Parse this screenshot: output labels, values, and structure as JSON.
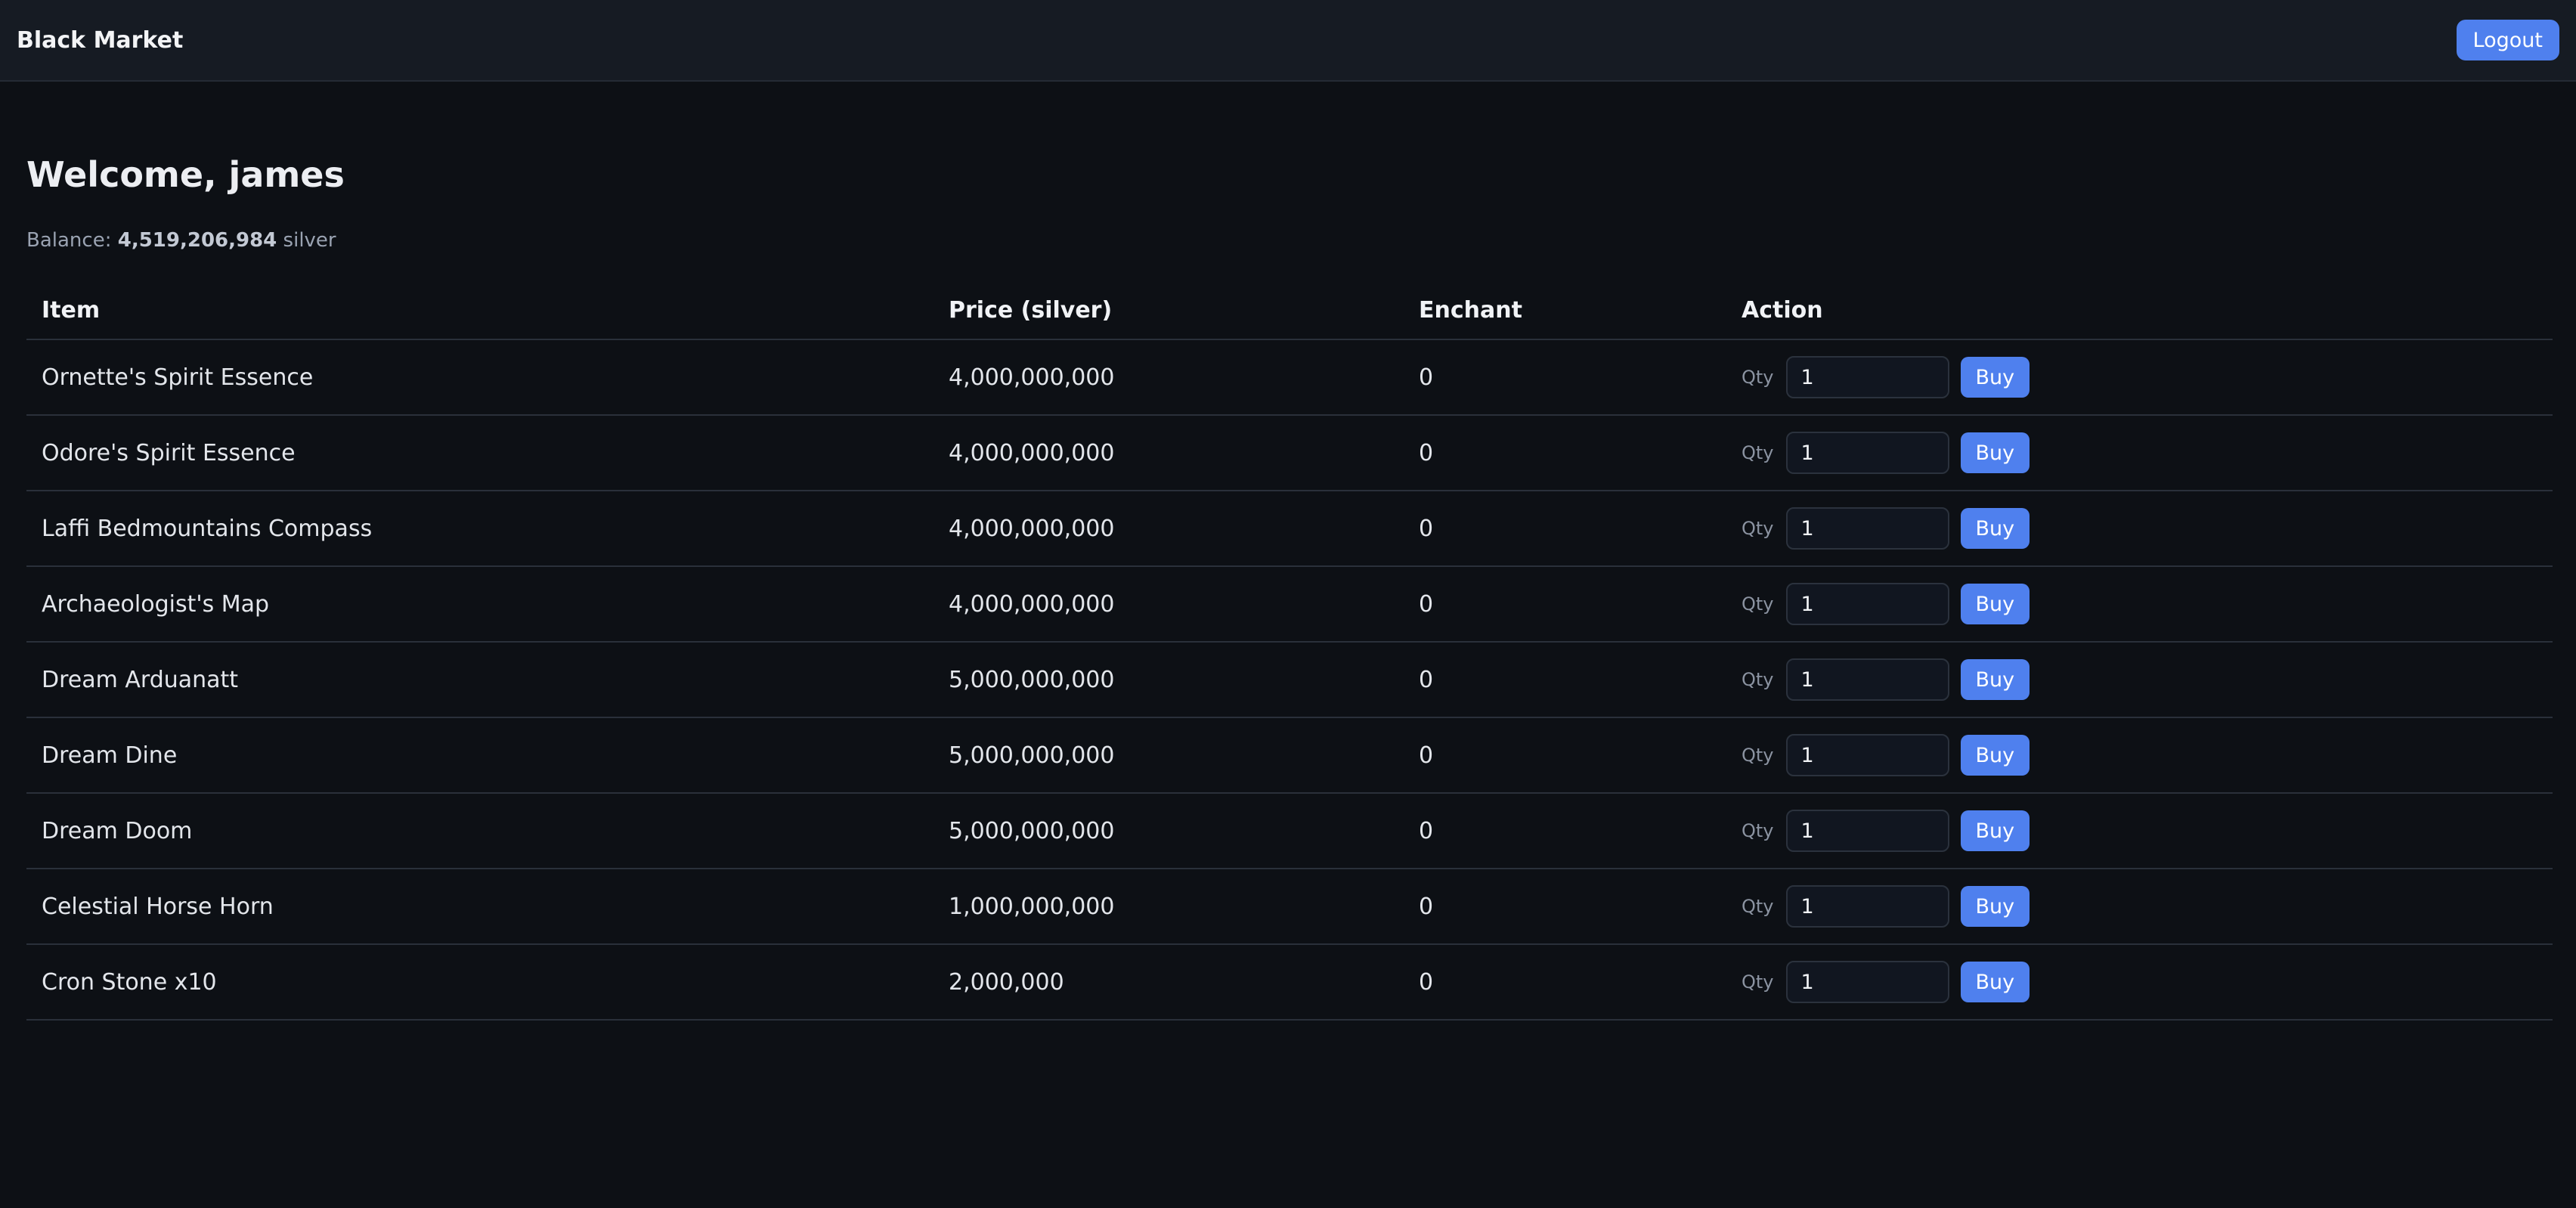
{
  "header": {
    "brand": "Black Market",
    "logout_label": "Logout"
  },
  "welcome": {
    "text": "Welcome, james"
  },
  "balance": {
    "label": "Balance: ",
    "amount": "4,519,206,984",
    "unit": " silver"
  },
  "table": {
    "columns": [
      "Item",
      "Price (silver)",
      "Enchant",
      "Action"
    ],
    "qty_label": "Qty",
    "buy_label": "Buy",
    "rows": [
      {
        "item": "Ornette's Spirit Essence",
        "price": "4,000,000,000",
        "enchant": "0",
        "qty": "1"
      },
      {
        "item": "Odore's Spirit Essence",
        "price": "4,000,000,000",
        "enchant": "0",
        "qty": "1"
      },
      {
        "item": "Laffi Bedmountains Compass",
        "price": "4,000,000,000",
        "enchant": "0",
        "qty": "1"
      },
      {
        "item": "Archaeologist's Map",
        "price": "4,000,000,000",
        "enchant": "0",
        "qty": "1"
      },
      {
        "item": "Dream Arduanatt",
        "price": "5,000,000,000",
        "enchant": "0",
        "qty": "1"
      },
      {
        "item": "Dream Dine",
        "price": "5,000,000,000",
        "enchant": "0",
        "qty": "1"
      },
      {
        "item": "Dream Doom",
        "price": "5,000,000,000",
        "enchant": "0",
        "qty": "1"
      },
      {
        "item": "Celestial Horse Horn",
        "price": "1,000,000,000",
        "enchant": "0",
        "qty": "1"
      },
      {
        "item": "Cron Stone x10",
        "price": "2,000,000",
        "enchant": "0",
        "qty": "1"
      }
    ]
  },
  "colors": {
    "background": "#0d1015",
    "topbar": "#161b23",
    "accent": "#4f80ee"
  }
}
